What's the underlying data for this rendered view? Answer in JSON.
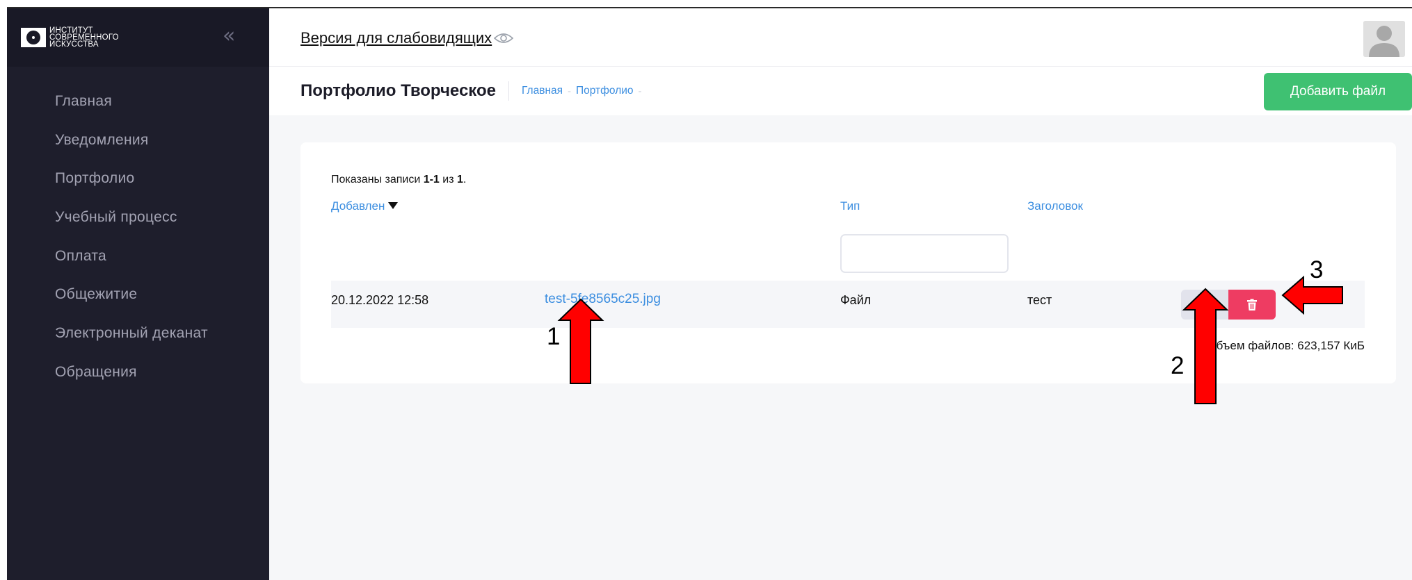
{
  "sidebar": {
    "logo_lines": [
      "Институт",
      "современного",
      "искусства"
    ],
    "collapse_glyph": "«",
    "items": [
      {
        "label": "Главная"
      },
      {
        "label": "Уведомления"
      },
      {
        "label": "Портфолио"
      },
      {
        "label": "Учебный процесс"
      },
      {
        "label": "Оплата"
      },
      {
        "label": "Общежитие"
      },
      {
        "label": "Электронный деканат"
      },
      {
        "label": "Обращения"
      }
    ]
  },
  "header": {
    "vision_link": "Версия для слабовидящих "
  },
  "subheader": {
    "title": "Портфолио Творческое",
    "breadcrumbs": [
      "Главная",
      "Портфолио"
    ],
    "add_button": "Добавить файл"
  },
  "table": {
    "summary_prefix": "Показаны записи ",
    "summary_range": "1-1",
    "summary_mid": " из ",
    "summary_total": "1",
    "summary_suffix": ".",
    "columns": {
      "added": "Добавлен",
      "type": "Тип",
      "title": "Заголовок"
    },
    "rows": [
      {
        "added": "20.12.2022 12:58",
        "file": "test-5fe8565c25.jpg",
        "type": "Файл",
        "title": "тест"
      }
    ],
    "storage": "Объем файлов: 623,157 КиБ"
  },
  "annotations": {
    "n1": "1",
    "n2": "2",
    "n3": "3",
    "arrow_color": "#ff0000"
  },
  "colors": {
    "sidebar": "#1e1e2c",
    "link": "#3c8ee0",
    "add_button": "#3fc172",
    "delete_button": "#ee3c62"
  }
}
